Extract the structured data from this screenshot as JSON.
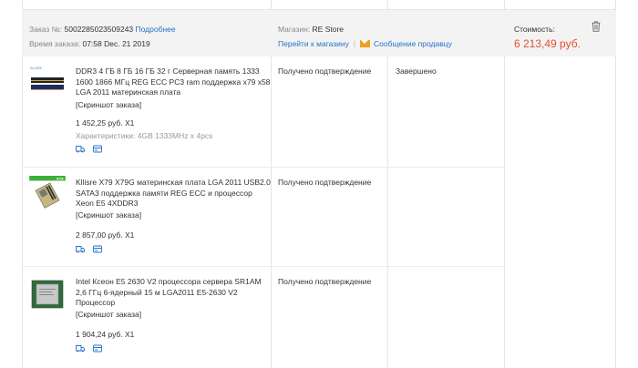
{
  "order": {
    "number_label": "Заказ №:",
    "number": "5002285023509243",
    "details_link": "Подробнее",
    "time_label": "Время заказа:",
    "time": "07:58 Dec. 21 2019",
    "store_label": "Магазин:",
    "store": "RE Store",
    "go_to_store": "Перейти к магазину",
    "separator": "|",
    "message_seller": "Сообщение продавцу",
    "cost_label": "Стоимость:",
    "cost": "6 213,49 руб.",
    "status": "Завершено"
  },
  "items": [
    {
      "title": "DDR3 4 ГБ 8 ГБ 16 ГБ 32 г Серверная память 1333 1600 1866 МГц REG ECC PC3 ram поддержка x79 x58 LGA 2011 материнская плата",
      "snapshot": "[Скриншот заказа]",
      "price": "1 452,25 руб. X1",
      "characteristics": "Характеристики: 4GB 1333MHz x 4pcs",
      "status": "Получено подтверждение"
    },
    {
      "title": "Kllisre X79 X79G материнская плата LGA 2011 USB2.0 SATA3 поддержка памяти REG ECC и процессор Xeon E5 4XDDR3",
      "snapshot": "[Скриншот заказа]",
      "price": "2 857,00 руб. X1",
      "status": "Получено подтверждение"
    },
    {
      "title": "Intel Ксеон E5 2630 V2 процессора сервера SR1AM 2,6 ГГц 6-ядерный 15 м LGA2011 E5-2630 V2 Процессор",
      "snapshot": "[Скриншот заказа]",
      "price": "1 904,24 руб. X1",
      "status": "Получено подтверждение"
    }
  ],
  "thumb_labels": {
    "ram_brand": "KLLISRE",
    "board_badge": "X79"
  },
  "colors": {
    "link": "#2673c8",
    "cost": "#e4502f",
    "header_bg": "#f3f3f3"
  }
}
